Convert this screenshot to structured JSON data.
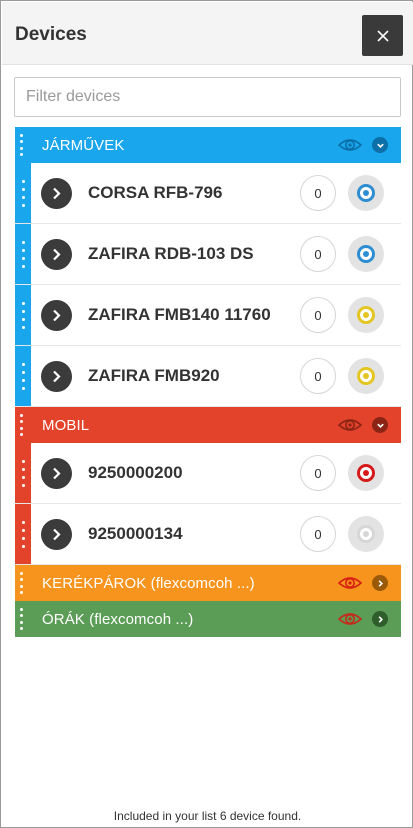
{
  "header": {
    "title": "Devices",
    "close_icon": "close-icon"
  },
  "filter": {
    "placeholder": "Filter devices",
    "value": ""
  },
  "colors": {
    "blue": "#1aa6ec",
    "red": "#e3432b",
    "orange": "#f7941d",
    "green": "#5b9d56",
    "status_blue": "#2f8ed1",
    "status_yellow": "#e3c623",
    "status_red": "#d51a1a",
    "status_grey": "#d6d6d6"
  },
  "groups": [
    {
      "name": "JÁRMŰVEK",
      "color": "blue",
      "expanded": true,
      "devices": [
        {
          "name": "CORSA RFB-796",
          "count": "0",
          "status": "blue"
        },
        {
          "name": "ZAFIRA RDB-103 DS",
          "count": "0",
          "status": "blue"
        },
        {
          "name": "ZAFIRA FMB140 11760",
          "count": "0",
          "status": "yellow"
        },
        {
          "name": "ZAFIRA FMB920",
          "count": "0",
          "status": "yellow"
        }
      ]
    },
    {
      "name": "MOBIL",
      "color": "red",
      "expanded": true,
      "devices": [
        {
          "name": "9250000200",
          "count": "0",
          "status": "red"
        },
        {
          "name": "9250000134",
          "count": "0",
          "status": "grey"
        }
      ]
    },
    {
      "name": "KERÉKPÁROK (flexcomcoh ...)",
      "color": "orange",
      "expanded": false,
      "devices": []
    },
    {
      "name": "ÓRÁK (flexcomcoh ...)",
      "color": "green",
      "expanded": false,
      "devices": []
    }
  ],
  "footer": {
    "text": "Included in your list 6 device found."
  }
}
